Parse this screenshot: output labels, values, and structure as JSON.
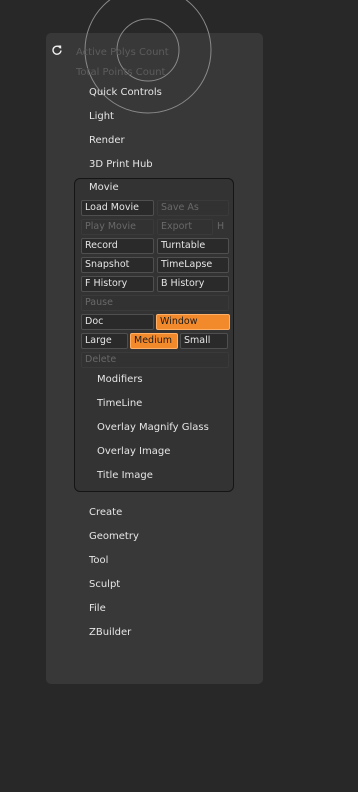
{
  "stats": {
    "active_polys_label": "Active Polys Count",
    "total_points_label": "Total Points Count"
  },
  "menu_top": {
    "quick_controls": "Quick Controls",
    "light": "Light",
    "render": "Render",
    "print_hub": "3D Print Hub"
  },
  "movie": {
    "title": "Movie",
    "load_movie": "Load Movie",
    "save_as": "Save As",
    "play_movie": "Play Movie",
    "export": "Export",
    "h": "H",
    "record": "Record",
    "turntable": "Turntable",
    "snapshot": "Snapshot",
    "timelapse": "TimeLapse",
    "f_history": "F History",
    "b_history": "B History",
    "pause": "Pause",
    "doc": "Doc",
    "window": "Window",
    "large": "Large",
    "medium": "Medium",
    "small": "Small",
    "delete": "Delete",
    "subpalettes": {
      "modifiers": "Modifiers",
      "timeline": "TimeLine",
      "overlay_magnify": "Overlay Magnify Glass",
      "overlay_image": "Overlay Image",
      "title_image": "Title Image"
    }
  },
  "menu_bottom": {
    "create": "Create",
    "geometry": "Geometry",
    "tool": "Tool",
    "sculpt": "Sculpt",
    "file": "File",
    "zbuilder": "ZBuilder"
  },
  "colors": {
    "accent": "#f28a2c",
    "panel": "#383838",
    "background": "#282828"
  },
  "icons": {
    "refresh": "refresh-icon"
  }
}
